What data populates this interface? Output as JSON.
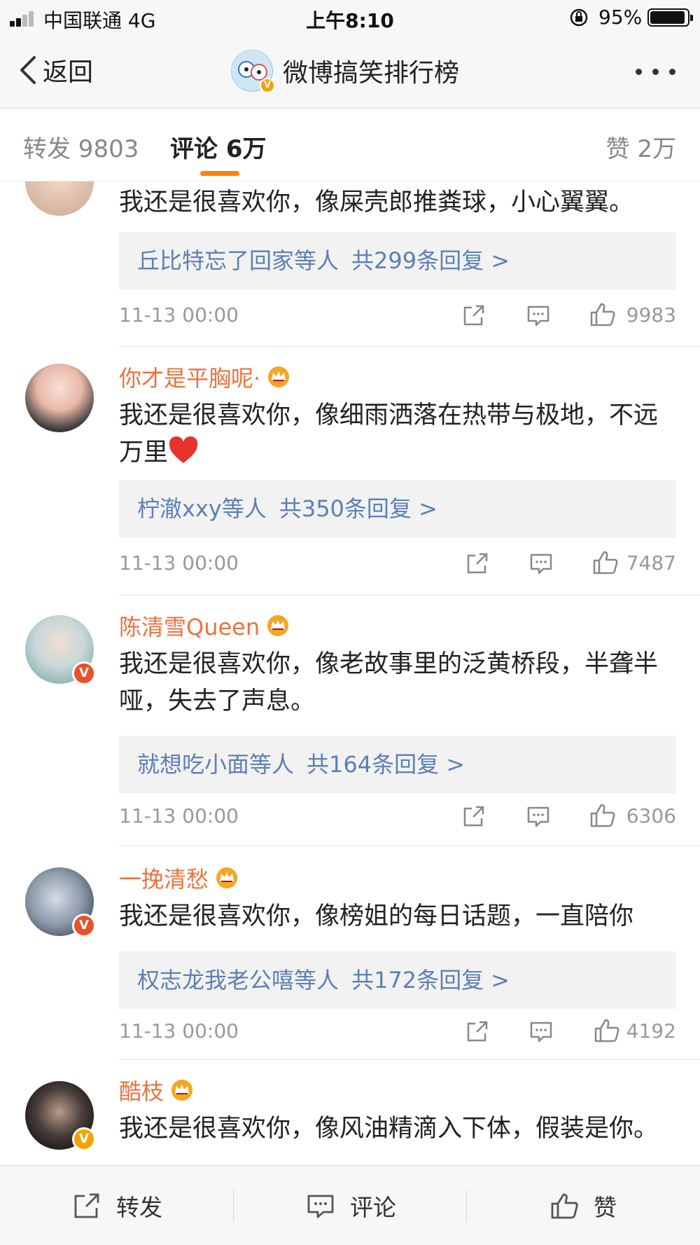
{
  "status_bar": {
    "carrier": "中国联通   4G",
    "time": "上午8:10",
    "battery_percent": "95%",
    "battery_level": 0.95,
    "signal_bars": 2
  },
  "nav": {
    "back_label": "返回",
    "title": "微博搞笑排行榜",
    "verified_badge": "V"
  },
  "tabs": [
    {
      "label": "转发 9803",
      "active": false
    },
    {
      "label": "评论 6万",
      "active": true
    },
    {
      "label": "赞 2万",
      "active": false
    }
  ],
  "comments": [
    {
      "name": "",
      "has_crown": false,
      "verified": false,
      "text": "我还是很喜欢你，像屎壳郎推粪球，小心翼翼。",
      "replies_user": "丘比特忘了回家等人",
      "replies_count": "共299条回复 >",
      "date": "11-13 00:00",
      "likes": "9983"
    },
    {
      "name": "你才是平胸呢·",
      "has_crown": true,
      "verified": false,
      "text": "我还是很喜欢你，像细雨洒落在热带与极地，不远万里",
      "has_heart": true,
      "replies_user": "柠澈xxy等人",
      "replies_count": "共350条回复 >",
      "date": "11-13 00:00",
      "likes": "7487"
    },
    {
      "name": "陈清雪Queen",
      "has_crown": true,
      "verified": true,
      "verified_color": "red",
      "text": "我还是很喜欢你，像老故事里的泛黄桥段，半聋半哑，失去了声息。",
      "replies_user": "就想吃小面等人",
      "replies_count": "共164条回复 >",
      "date": "11-13 00:00",
      "likes": "6306"
    },
    {
      "name": "一挽清愁",
      "has_crown": true,
      "verified": true,
      "verified_color": "red",
      "text": "我还是很喜欢你，像榜姐的每日话题，一直陪你",
      "replies_user": "权志龙我老公嘻等人",
      "replies_count": "共172条回复 >",
      "date": "11-13 00:00",
      "likes": "4192"
    },
    {
      "name": "酷枝",
      "has_crown": true,
      "verified": true,
      "verified_color": "orange",
      "text": "我还是很喜欢你，像风油精滴入下体，假装是你。"
    }
  ],
  "bottom_bar": {
    "repost_label": "转发",
    "comment_label": "评论",
    "like_label": "赞"
  },
  "colors": {
    "accent": "#ff8200",
    "username": "#eb7340",
    "reply_link": "#5d7fb4"
  }
}
